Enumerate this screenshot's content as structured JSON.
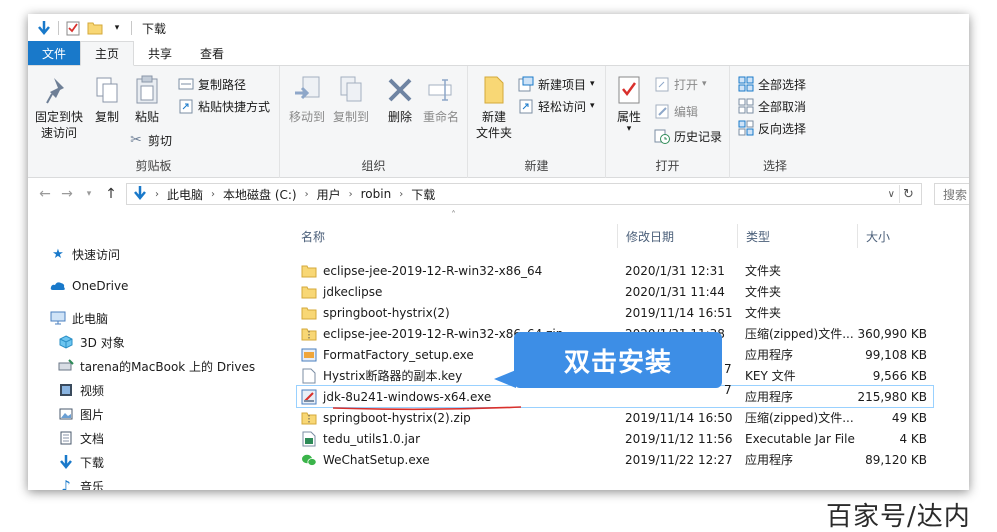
{
  "window": {
    "title": "下载"
  },
  "tabs": [
    {
      "label": "文件"
    },
    {
      "label": "主页"
    },
    {
      "label": "共享"
    },
    {
      "label": "查看"
    }
  ],
  "ribbon": {
    "clipboard": {
      "label": "剪贴板",
      "pin": "固定到快\n速访问",
      "pin_l1": "固定到快",
      "pin_l2": "速访问",
      "copy": "复制",
      "paste": "粘贴",
      "copy_path": "复制路径",
      "paste_shortcut": "粘贴快捷方式",
      "cut": "剪切"
    },
    "organize": {
      "label": "组织",
      "move_to": "移动到",
      "copy_to": "复制到",
      "delete": "删除",
      "rename": "重命名"
    },
    "new": {
      "label": "新建",
      "new_folder_l1": "新建",
      "new_folder_l2": "文件夹",
      "new_item": "新建项目",
      "easy_access": "轻松访问"
    },
    "open": {
      "label": "打开",
      "properties": "属性",
      "open": "打开",
      "edit": "编辑",
      "history": "历史记录"
    },
    "select": {
      "label": "选择",
      "select_all": "全部选择",
      "select_none": "全部取消",
      "invert": "反向选择"
    }
  },
  "address": {
    "path": [
      "此电脑",
      "本地磁盘 (C:)",
      "用户",
      "robin",
      "下载"
    ],
    "search_placeholder": "搜索"
  },
  "sidebar": {
    "items": [
      {
        "label": "快速访问",
        "icon": "star-icon"
      },
      {
        "label": "OneDrive",
        "icon": "cloud-icon"
      },
      {
        "label": "此电脑",
        "icon": "computer-icon"
      },
      {
        "label": "3D 对象",
        "icon": "cube-icon"
      },
      {
        "label": "tarena的MacBook  上的 Drives",
        "icon": "network-drive-icon"
      },
      {
        "label": "视频",
        "icon": "video-icon"
      },
      {
        "label": "图片",
        "icon": "picture-icon"
      },
      {
        "label": "文档",
        "icon": "document-icon"
      },
      {
        "label": "下载",
        "icon": "download-icon"
      },
      {
        "label": "音乐",
        "icon": "music-icon"
      }
    ]
  },
  "columns": {
    "name": "名称",
    "date": "修改日期",
    "type": "类型",
    "size": "大小"
  },
  "files": [
    {
      "name": "eclipse-jee-2019-12-R-win32-x86_64",
      "date": "2020/1/31 12:31",
      "type": "文件夹",
      "size": "",
      "icon": "folder-icon"
    },
    {
      "name": "jdkeclipse",
      "date": "2020/1/31 11:44",
      "type": "文件夹",
      "size": "",
      "icon": "folder-icon"
    },
    {
      "name": "springboot-hystrix(2)",
      "date": "2019/11/14 16:51",
      "type": "文件夹",
      "size": "",
      "icon": "folder-icon"
    },
    {
      "name": "eclipse-jee-2019-12-R-win32-x86_64.zip",
      "date": "2020/1/31 11:38",
      "type": "压缩(zipped)文件...",
      "size": "360,990 KB",
      "icon": "zip-icon"
    },
    {
      "name": "FormatFactory_setup.exe",
      "date": "",
      "type": "应用程序",
      "size": "99,108 KB",
      "icon": "exe-icon"
    },
    {
      "name": "Hystrix断路器的副本.key",
      "date": "",
      "type": "KEY 文件",
      "size": "9,566 KB",
      "icon": "file-icon"
    },
    {
      "name": "jdk-8u241-windows-x64.exe",
      "date": "",
      "type": "应用程序",
      "size": "215,980 KB",
      "icon": "installer-icon"
    },
    {
      "name": "springboot-hystrix(2).zip",
      "date": "2019/11/14 16:50",
      "type": "压缩(zipped)文件...",
      "size": "49 KB",
      "icon": "zip-icon"
    },
    {
      "name": "tedu_utils1.0.jar",
      "date": "2019/11/12 11:56",
      "type": "Executable Jar File",
      "size": "4 KB",
      "icon": "jar-icon"
    },
    {
      "name": "WeChatSetup.exe",
      "date": "2019/11/22 12:27",
      "type": "应用程序",
      "size": "89,120 KB",
      "icon": "wechat-icon"
    }
  ],
  "date_fragments": {
    "formatfactory": "7",
    "hystrix_key": "7"
  },
  "callout": "双击安装",
  "watermark": "百家号/达内",
  "colors": {
    "accent": "#1979ca",
    "callout": "#3d8ee6",
    "folder": "#f8d775",
    "underline": "#d9302c"
  }
}
